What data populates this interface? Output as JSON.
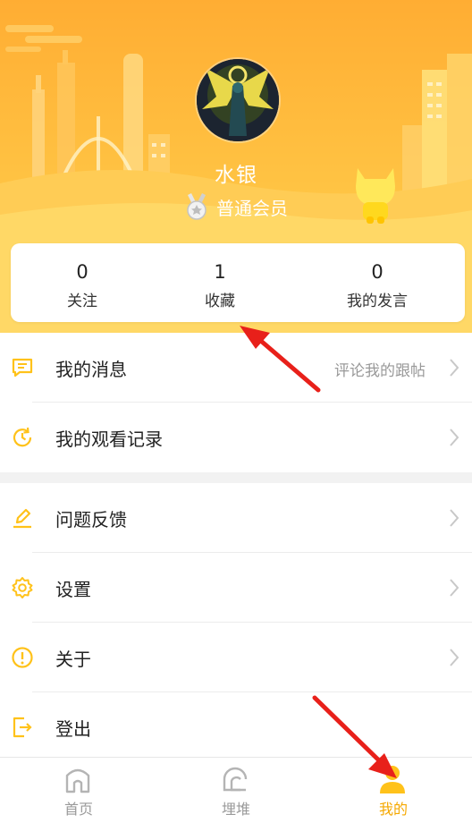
{
  "profile": {
    "username": "水银",
    "member_level": "普通会员"
  },
  "stats": [
    {
      "value": "0",
      "label": "关注"
    },
    {
      "value": "1",
      "label": "收藏"
    },
    {
      "value": "0",
      "label": "我的发言"
    }
  ],
  "menu": {
    "group1": [
      {
        "label": "我的消息",
        "sub": "评论我的跟帖",
        "icon": "message-icon"
      },
      {
        "label": "我的观看记录",
        "sub": "",
        "icon": "history-clock-icon"
      }
    ],
    "group2": [
      {
        "label": "问题反馈",
        "icon": "edit-pencil-icon"
      },
      {
        "label": "设置",
        "icon": "gear-icon"
      },
      {
        "label": "关于",
        "icon": "info-exclamation-icon"
      },
      {
        "label": "登出",
        "icon": "logout-icon"
      }
    ]
  },
  "tabs": [
    {
      "label": "首页",
      "icon": "home-icon",
      "active": false
    },
    {
      "label": "埋堆",
      "icon": "community-icon",
      "active": false
    },
    {
      "label": "我的",
      "icon": "person-icon",
      "active": true
    }
  ],
  "colors": {
    "accent": "#ffc21a",
    "active_tab": "#f5a800",
    "header_top": "#ffad33",
    "header_bottom": "#ffd34f",
    "arrow": "#e8201a"
  }
}
